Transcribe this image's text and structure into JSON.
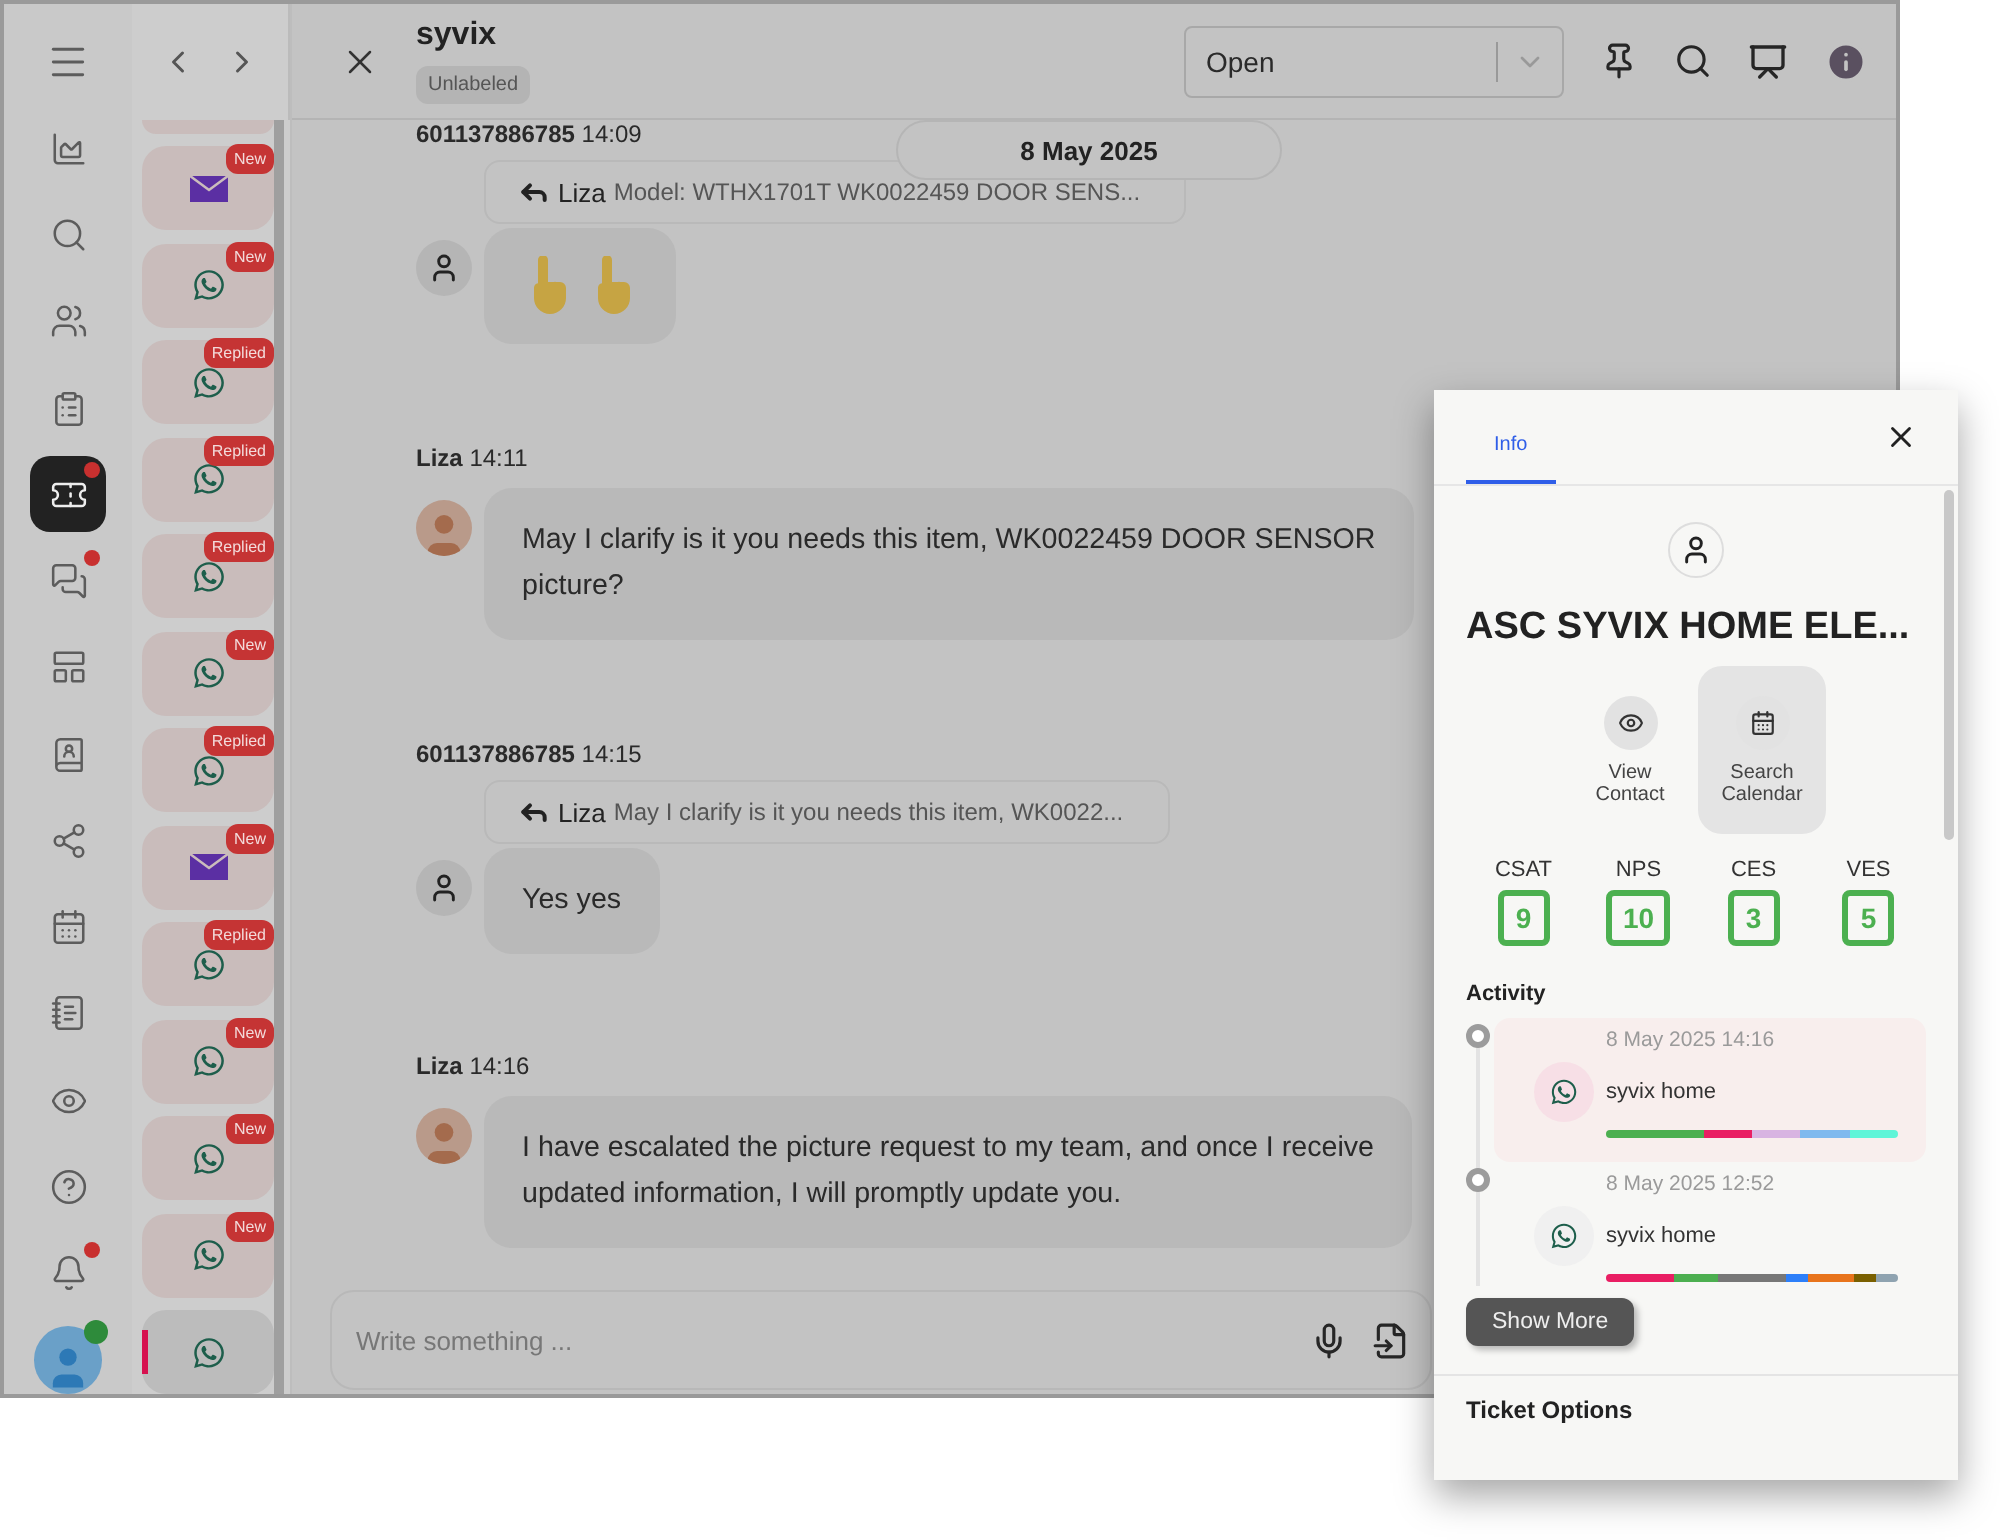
{
  "rail": {
    "items": [
      {
        "selected": false,
        "alert": false
      },
      {
        "selected": false,
        "alert": false
      },
      {
        "selected": false,
        "alert": false
      },
      {
        "selected": false,
        "alert": false
      },
      {
        "selected": false,
        "alert": false
      },
      {
        "selected": true,
        "alert": true
      },
      {
        "selected": false,
        "alert": true
      },
      {
        "selected": false,
        "alert": false
      },
      {
        "selected": false,
        "alert": false
      },
      {
        "selected": false,
        "alert": false
      },
      {
        "selected": false,
        "alert": false
      },
      {
        "selected": false,
        "alert": false
      },
      {
        "selected": false,
        "alert": false
      },
      {
        "selected": false,
        "alert": false
      },
      {
        "selected": false,
        "alert": true
      }
    ],
    "user": {
      "online": true
    }
  },
  "conversations": [
    {
      "kind": "email",
      "badge": "New",
      "selected": false
    },
    {
      "kind": "whatsapp",
      "badge": "New",
      "selected": false
    },
    {
      "kind": "whatsapp",
      "badge": "Replied",
      "selected": false
    },
    {
      "kind": "whatsapp",
      "badge": "Replied",
      "selected": false
    },
    {
      "kind": "whatsapp",
      "badge": "Replied",
      "selected": false
    },
    {
      "kind": "whatsapp",
      "badge": "New",
      "selected": false
    },
    {
      "kind": "whatsapp",
      "badge": "Replied",
      "selected": false
    },
    {
      "kind": "email",
      "badge": "New",
      "selected": false
    },
    {
      "kind": "whatsapp",
      "badge": "Replied",
      "selected": false
    },
    {
      "kind": "whatsapp",
      "badge": "New",
      "selected": false
    },
    {
      "kind": "whatsapp",
      "badge": "New",
      "selected": false
    },
    {
      "kind": "whatsapp",
      "badge": "New",
      "selected": false
    },
    {
      "kind": "whatsapp",
      "selected": true
    }
  ],
  "header": {
    "title": "syvix",
    "label": "Unlabeled",
    "status": "Open"
  },
  "date_pill": "8 May 2025",
  "messages": [
    {
      "sender": "601137886785",
      "time": "14:09",
      "from_agent": false,
      "quote": {
        "author": "Liza",
        "text": "Model: WTHX1701T WK0022459 DOOR SENS..."
      },
      "kind": "hands"
    },
    {
      "sender": "Liza",
      "time": "14:11",
      "from_agent": true,
      "kind": "text",
      "lines": [
        "May I clarify is it you needs this item, WK0022459 DOOR SENSOR",
        "picture?"
      ]
    },
    {
      "sender": "601137886785",
      "time": "14:15",
      "from_agent": false,
      "quote": {
        "author": "Liza",
        "text": "May I clarify is it you needs this item, WK0022..."
      },
      "kind": "text",
      "lines": [
        "Yes yes"
      ]
    },
    {
      "sender": "Liza",
      "time": "14:16",
      "from_agent": true,
      "kind": "text",
      "lines": [
        "I have escalated the picture request to my team, and once I receive",
        "updated information, I will promptly update you."
      ]
    }
  ],
  "composer": {
    "placeholder": "Write something ..."
  },
  "info_panel": {
    "tabs": [
      {
        "label": "Info",
        "selected": true
      }
    ],
    "name": "ASC SYVIX HOME ELE...",
    "actions": [
      {
        "label": "View Contact",
        "kind": "view",
        "selected": false
      },
      {
        "label": "Search Calendar",
        "kind": "calendar",
        "selected": true
      }
    ],
    "scores": [
      {
        "label": "CSAT",
        "value": "9"
      },
      {
        "label": "NPS",
        "value": "10"
      },
      {
        "label": "CES",
        "value": "3"
      },
      {
        "label": "VES",
        "value": "5"
      }
    ],
    "activity_title": "Activity",
    "activity": [
      {
        "date": "8 May 2025 14:16",
        "name": "syvix home",
        "selected": true,
        "segments": [
          {
            "color": "#4caf50"
          },
          {
            "color": "#4caf50"
          },
          {
            "color": "#e91e63"
          },
          {
            "color": "#d8b4e2"
          },
          {
            "color": "#80b9ee"
          },
          {
            "color": "#5ff5d8"
          }
        ]
      },
      {
        "date": "8 May 2025 12:52",
        "name": "syvix home",
        "selected": false,
        "segments": [
          {
            "color": "#e91e63"
          },
          {
            "color": "#e91e63"
          },
          {
            "color": "#e91e63"
          },
          {
            "color": "#4caf50"
          },
          {
            "color": "#4caf50"
          },
          {
            "color": "#777777"
          },
          {
            "color": "#777777"
          },
          {
            "color": "#777777"
          },
          {
            "color": "#2d7ff9"
          },
          {
            "color": "#e8741c"
          },
          {
            "color": "#e8741c"
          },
          {
            "color": "#7a6000"
          },
          {
            "color": "#8fa3b0"
          }
        ]
      }
    ],
    "show_more": "Show More",
    "ticket_options": "Ticket Options"
  }
}
